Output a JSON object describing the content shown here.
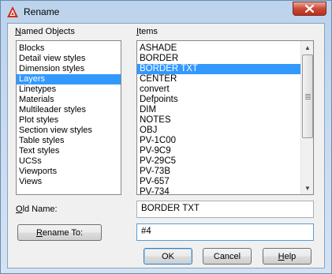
{
  "window": {
    "title": "Rename",
    "close_icon": "close-icon",
    "app_icon": "autocad-logo-icon",
    "accent": "#3399ff"
  },
  "named_objects": {
    "label": "Named Objects",
    "items": [
      "Blocks",
      "Detail view styles",
      "Dimension styles",
      "Layers",
      "Linetypes",
      "Materials",
      "Multileader styles",
      "Plot styles",
      "Section view styles",
      "Table styles",
      "Text styles",
      "UCSs",
      "Viewports",
      "Views"
    ],
    "selected": "Layers"
  },
  "items_list": {
    "label": "Items",
    "items": [
      "ASHADE",
      "BORDER",
      "BORDER TXT",
      "CENTER",
      "convert",
      "Defpoints",
      "DIM",
      "NOTES",
      "OBJ",
      "PV-1C00",
      "PV-9C9",
      "PV-29C5",
      "PV-73B",
      "PV-657",
      "PV-734"
    ],
    "selected": "BORDER TXT"
  },
  "old_name": {
    "label": "Old Name:",
    "value": "BORDER TXT"
  },
  "rename_to": {
    "button_label": "Rename To:",
    "value": "#4"
  },
  "buttons": {
    "ok": "OK",
    "cancel": "Cancel",
    "help": "Help"
  }
}
